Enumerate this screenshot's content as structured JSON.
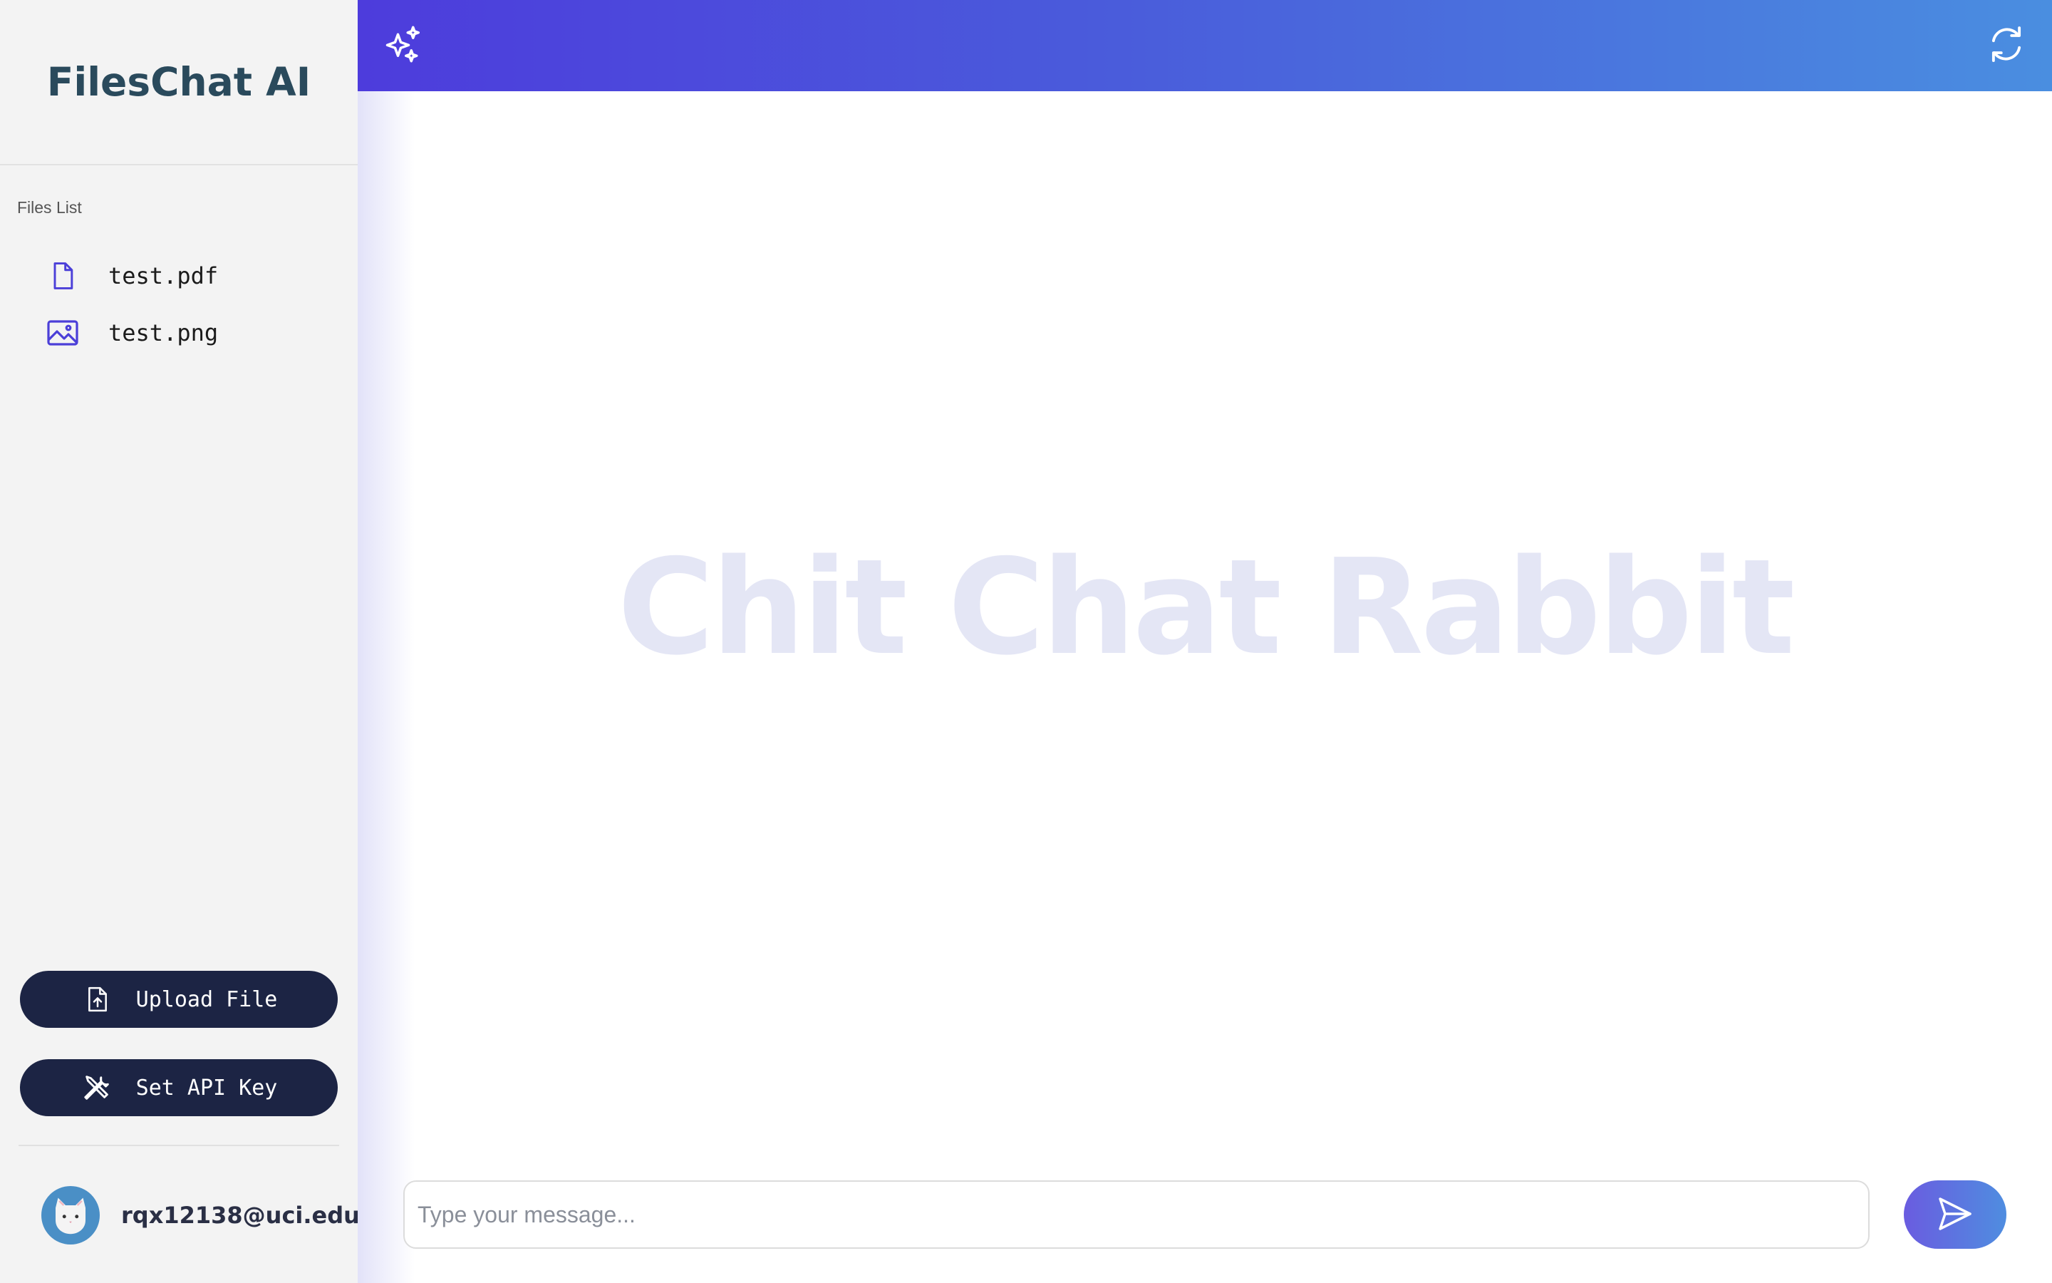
{
  "sidebar": {
    "title": "FilesChat AI",
    "files_label": "Files List",
    "files": [
      {
        "name": "test.pdf",
        "icon": "document-icon"
      },
      {
        "name": "test.png",
        "icon": "image-icon"
      }
    ],
    "upload_label": "Upload File",
    "api_key_label": "Set API Key",
    "user_email": "rqx12138@uci.edu"
  },
  "header": {
    "left_icon": "sparkles-icon",
    "right_icon": "refresh-icon"
  },
  "main": {
    "watermark": "Chit Chat Rabbit"
  },
  "composer": {
    "placeholder": "Type your message...",
    "send_icon": "send-icon"
  },
  "colors": {
    "brand_text": "#2a4a5c",
    "button_bg": "#1c2444",
    "header_gradient_start": "#4d3cdc",
    "header_gradient_end": "#4a8ee0",
    "icon_accent": "#4b3fd8",
    "watermark": "#e4e6f5"
  }
}
